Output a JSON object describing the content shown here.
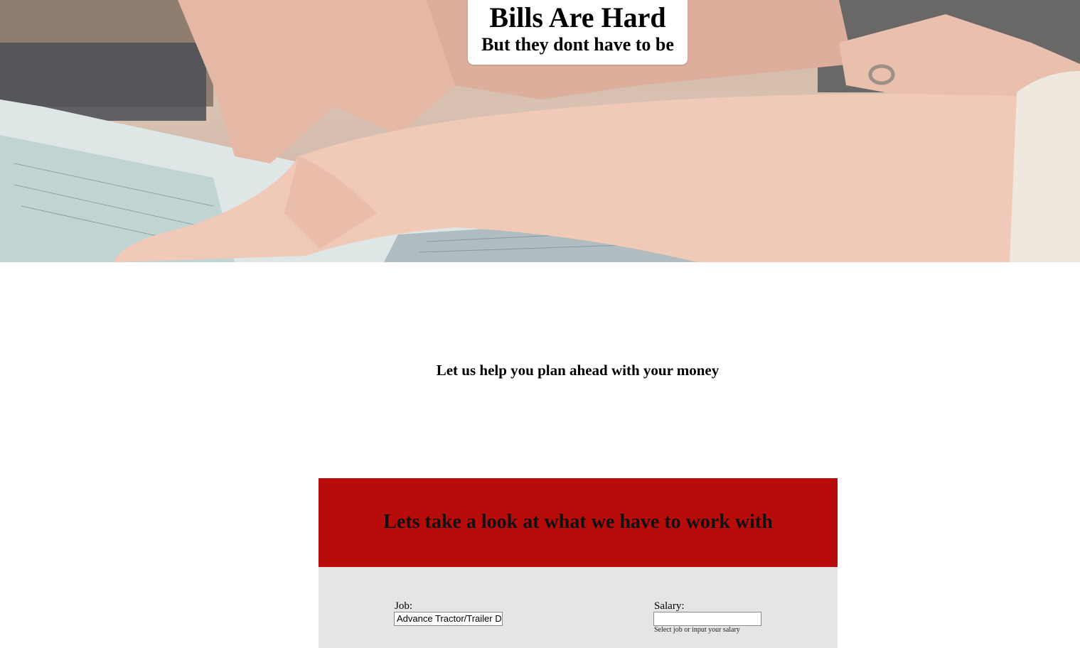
{
  "hero": {
    "title": "Bills Are Hard",
    "subtitle": "But they dont have to be"
  },
  "tagline": "Let us help you plan ahead with your money",
  "panel": {
    "heading": "Lets take a look at what we have to work with",
    "job": {
      "label": "Job:",
      "value": "Advance Tractor/Trailer Driver"
    },
    "salary": {
      "label": "Salary:",
      "value": "",
      "hint": "Select job or input your salary"
    }
  },
  "colors": {
    "panel_header": "#b80c0a",
    "panel_body": "#e5e5e5"
  }
}
